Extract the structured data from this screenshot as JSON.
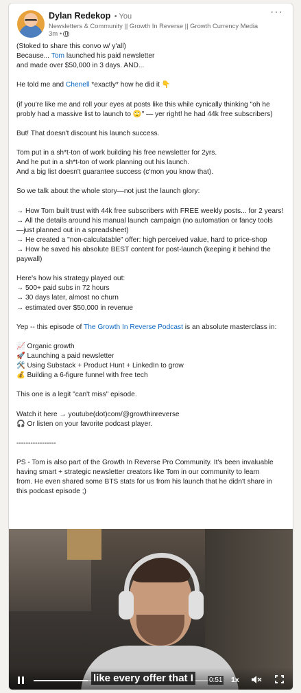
{
  "post": {
    "author_name": "Dylan Redekop",
    "author_badge": "• You",
    "headline": "Newsletters & Community || Growth In Reverse || Growth Currency Media",
    "time_ago": "3m •",
    "more_icon": "ellipsis-icon",
    "lines": [
      "(Stoked to share this convo w/ y'all)",
      "Because... |Tom| launched his paid newsletter",
      "and made over $50,000 in 3 days. AND...",
      "",
      "He told me and |Chenell| *exactly* how he did it 👇",
      "",
      "(if you're like me and roll your eyes at posts like this while cynically thinking \"oh he",
      "probly had a massive list to launch to 🙄\" — yer right! he had 44k free subscribers)",
      "",
      "But! That doesn't discount his launch success.",
      "",
      "Tom put in a sh*t-ton of work building his free newsletter for 2yrs.",
      "And he put in a sh*t-ton of work planning out his launch.",
      "And a big list doesn't guarantee success (c'mon you know that).",
      "",
      "So we talk about the whole story—not just the launch glory:",
      "",
      "→ How Tom built trust with 44k free subscribers with FREE weekly posts... for 2 years!",
      "→ All the details around his manual launch campaign (no automation or fancy tools",
      "—just planned out in a spreadsheet)",
      "→ He created a \"non-calculatable\" offer: high perceived value, hard to price-shop",
      "→ How he saved his absolute BEST content for post-launch (keeping it behind the",
      "paywall)",
      "",
      "Here's how his strategy played out:",
      "→ 500+ paid subs in 72 hours",
      "→ 30 days later, almost no churn",
      "→ estimated over $50,000 in revenue",
      "",
      "Yep -- this episode of |The Growth In Reverse Podcast| is an absolute masterclass in:",
      "",
      "📈 Organic growth",
      "🚀 Launching a paid newsletter",
      "🛠️ Using Substack + Product Hunt + LinkedIn to grow",
      "💰 Building a 6-figure funnel with free tech",
      "",
      "This one is a legit \"can't miss\" episode.",
      "",
      "Watch it here → youtube(dot)com/@growthinreverse",
      "🎧 Or listen on your favorite podcast player.",
      "",
      "-----------------",
      "",
      "PS - Tom is also part of the Growth In Reverse Pro Community. It's been invaluable",
      "having smart + strategic newsletter creators like Tom in our community to learn",
      "from. He even shared some BTS stats for us from his launch that he didn't share in",
      "this podcast episode ;)"
    ]
  },
  "video": {
    "caption": "like every offer that I",
    "current_time": "0:51",
    "playback_speed": "1x",
    "progress": 0.29,
    "icons": {
      "pause": "pause-icon",
      "mute": "muted-speaker-icon",
      "fullscreen": "fullscreen-icon"
    }
  },
  "colors": {
    "link": "#0a66c2",
    "page_bg": "#f3f2ef",
    "card_bg": "#ffffff"
  }
}
